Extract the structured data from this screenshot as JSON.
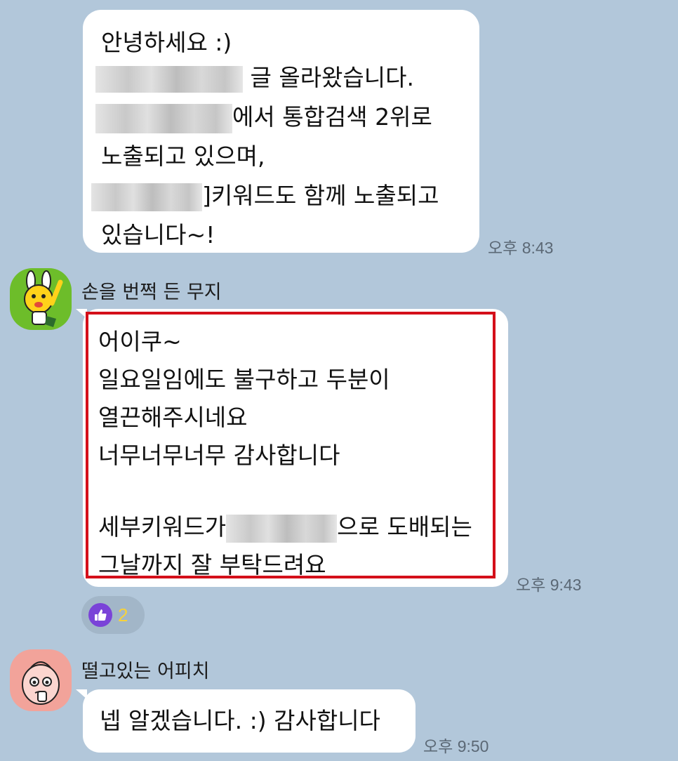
{
  "messages": [
    {
      "lines": [
        "안녕하세요 :)",
        " 글 올라왔습니다.",
        "에서 통합검색 2위로",
        "노출되고 있으며,",
        "]키워드도 함께 노출되고",
        "있습니다~!"
      ],
      "time": "오후 8:43"
    },
    {
      "sender": "손을 번쩍 든 무지",
      "lines": [
        "어이쿠~",
        "일요일임에도 불구하고 두분이",
        "열끈해주시네요",
        "너무너무너무 감사합니다",
        "세부키워드가",
        "으로 도배되는",
        "그날까지 잘 부탁드려요"
      ],
      "time": "오후 9:43",
      "reaction": {
        "icon": "thumbs-up-icon",
        "count": "2",
        "color": "#7a43d8"
      }
    },
    {
      "sender": "떨고있는 어피치",
      "lines": [
        "넵 알겠습니다. :) 감사합니다"
      ],
      "time": "오후 9:50"
    }
  ],
  "colors": {
    "background": "#b2c7da",
    "highlight": "#d40f1a"
  }
}
